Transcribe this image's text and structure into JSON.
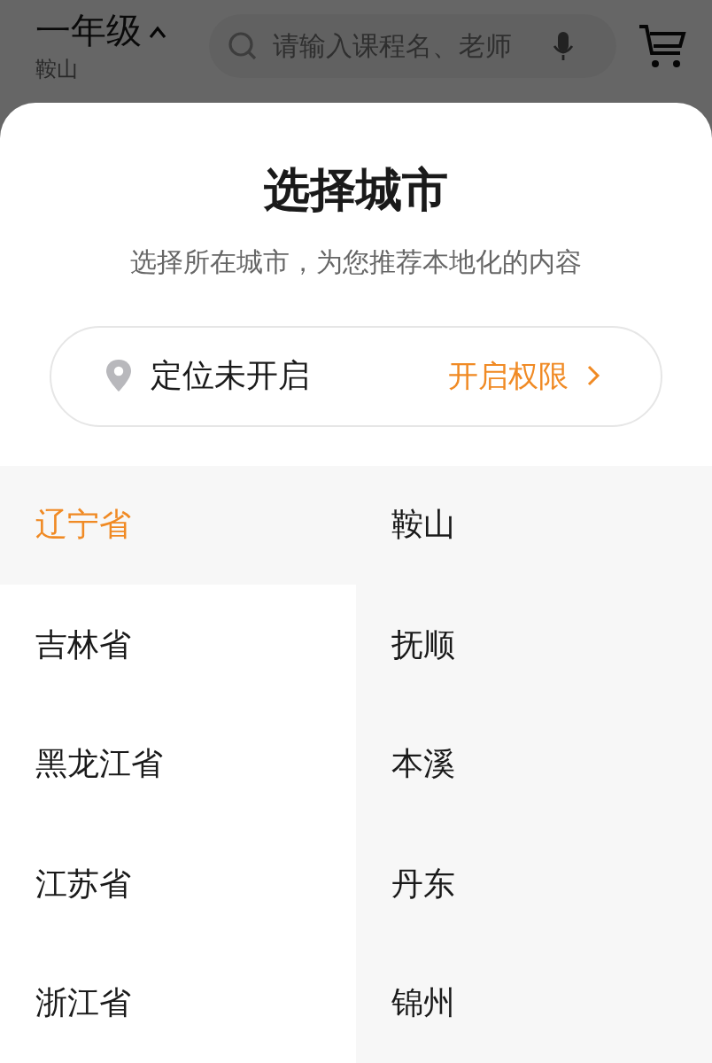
{
  "header": {
    "grade": "一年级",
    "city": "鞍山",
    "search": {
      "placeholder": "请输入课程名、老师"
    }
  },
  "sheet": {
    "title": "选择城市",
    "subtitle": "选择所在城市，为您推荐本地化的内容",
    "location": {
      "status": "定位未开启",
      "action": "开启权限"
    },
    "provinces": [
      {
        "name": "辽宁省",
        "selected": true
      },
      {
        "name": "吉林省",
        "selected": false
      },
      {
        "name": "黑龙江省",
        "selected": false
      },
      {
        "name": "江苏省",
        "selected": false
      },
      {
        "name": "浙江省",
        "selected": false
      }
    ],
    "cities": [
      "鞍山",
      "抚顺",
      "本溪",
      "丹东",
      "锦州"
    ]
  }
}
